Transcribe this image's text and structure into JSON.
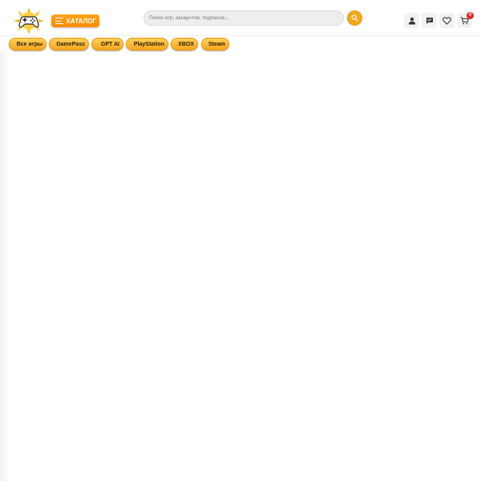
{
  "header": {
    "catalog_label": "КАТАЛОГ",
    "search": {
      "placeholder": "Поиск игр, аккаунтов, подписок..."
    },
    "cart_count": "0"
  },
  "icons": {
    "logo": "gamepad-sun-logo",
    "catalog": "menu-icon",
    "search": "search-icon",
    "profile": "user-icon",
    "messages": "chat-icon",
    "favorites": "heart-icon",
    "cart": "cart-icon"
  },
  "categories": [
    {
      "label": "Все игры"
    },
    {
      "label": "GamePass"
    },
    {
      "label": "GPT AI"
    },
    {
      "label": "PlayStation"
    },
    {
      "label": "XBOX"
    },
    {
      "label": "Steam"
    }
  ],
  "colors": {
    "accent": "#f5a51c",
    "catalog_button": "#ff8c00",
    "badge": "#e8232b"
  }
}
